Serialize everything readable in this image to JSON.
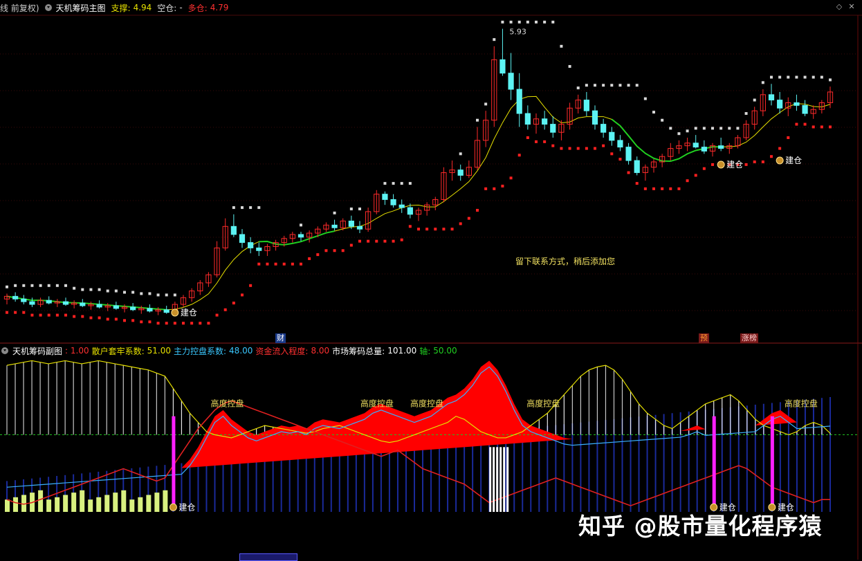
{
  "header": {
    "mode": "线 前复权)",
    "indicator": "天机筹码主图",
    "support_label": "支撑:",
    "support_value": "4.94",
    "empty_label": "空仓:",
    "empty_value": "-",
    "long_label": "多仓:",
    "long_value": "4.79"
  },
  "sub_header": {
    "indicator": "天机筹码副图",
    "param0": ": 1.00",
    "retail_label": "散户套牢系数:",
    "retail_value": "51.00",
    "main_label": "主力控盘系数:",
    "main_value": "48.00",
    "inflow_label": "资金流入程度:",
    "inflow_value": "8.00",
    "total_label": "市场筹码总量:",
    "total_value": "101.00",
    "axis_label": "轴:",
    "axis_value": "50.00"
  },
  "annotations": {
    "peak_price": "5.93",
    "note": "留下联系方式，稍后添加您",
    "build_label": "建仓",
    "high_control_label": "高度控盘",
    "marker_cai": "财",
    "marker_yu": "预",
    "marker_zhangting": "涨榜"
  },
  "watermark": "知乎 @股市量化程序猿",
  "colors": {
    "up": "#ff2a2a",
    "down": "#5cf3f3",
    "bg": "#000000",
    "support": "#d8d8d8",
    "long_line": "#ff2020",
    "yellow": "#e6e000",
    "green": "#20d020",
    "magenta": "#ff20ff",
    "navy": "#1a2a9a"
  },
  "chart_data": [
    {
      "type": "candlestick",
      "title": "天机筹码主图",
      "candles": [
        [
          3.92,
          3.96,
          3.88,
          3.94
        ],
        [
          3.94,
          3.97,
          3.9,
          3.92
        ],
        [
          3.92,
          3.95,
          3.88,
          3.9
        ],
        [
          3.9,
          3.93,
          3.86,
          3.88
        ],
        [
          3.88,
          3.93,
          3.86,
          3.91
        ],
        [
          3.91,
          3.94,
          3.88,
          3.89
        ],
        [
          3.89,
          3.92,
          3.86,
          3.9
        ],
        [
          3.9,
          3.93,
          3.87,
          3.88
        ],
        [
          3.88,
          3.91,
          3.85,
          3.89
        ],
        [
          3.89,
          3.92,
          3.86,
          3.87
        ],
        [
          3.87,
          3.9,
          3.84,
          3.88
        ],
        [
          3.88,
          3.91,
          3.85,
          3.86
        ],
        [
          3.86,
          3.89,
          3.83,
          3.87
        ],
        [
          3.87,
          3.9,
          3.84,
          3.85
        ],
        [
          3.85,
          3.88,
          3.82,
          3.86
        ],
        [
          3.86,
          3.89,
          3.83,
          3.84
        ],
        [
          3.84,
          3.87,
          3.81,
          3.85
        ],
        [
          3.85,
          3.88,
          3.82,
          3.83
        ],
        [
          3.83,
          3.86,
          3.8,
          3.84
        ],
        [
          3.84,
          3.87,
          3.81,
          3.82
        ],
        [
          3.82,
          3.9,
          3.8,
          3.88
        ],
        [
          3.88,
          3.95,
          3.86,
          3.93
        ],
        [
          3.93,
          4.0,
          3.9,
          3.98
        ],
        [
          3.98,
          4.06,
          3.95,
          4.04
        ],
        [
          4.04,
          4.12,
          4.01,
          4.1
        ],
        [
          4.1,
          4.35,
          4.08,
          4.3
        ],
        [
          4.3,
          4.52,
          4.28,
          4.46
        ],
        [
          4.46,
          4.55,
          4.38,
          4.4
        ],
        [
          4.4,
          4.44,
          4.3,
          4.34
        ],
        [
          4.34,
          4.38,
          4.26,
          4.3
        ],
        [
          4.3,
          4.34,
          4.24,
          4.28
        ],
        [
          4.28,
          4.33,
          4.24,
          4.31
        ],
        [
          4.31,
          4.36,
          4.28,
          4.34
        ],
        [
          4.34,
          4.39,
          4.31,
          4.37
        ],
        [
          4.37,
          4.42,
          4.34,
          4.4
        ],
        [
          4.4,
          4.42,
          4.35,
          4.38
        ],
        [
          4.38,
          4.43,
          4.34,
          4.41
        ],
        [
          4.41,
          4.46,
          4.38,
          4.44
        ],
        [
          4.44,
          4.49,
          4.42,
          4.47
        ],
        [
          4.47,
          4.51,
          4.43,
          4.45
        ],
        [
          4.45,
          4.52,
          4.43,
          4.5
        ],
        [
          4.5,
          4.54,
          4.44,
          4.46
        ],
        [
          4.46,
          4.5,
          4.41,
          4.44
        ],
        [
          4.44,
          4.6,
          4.42,
          4.57
        ],
        [
          4.57,
          4.73,
          4.55,
          4.7
        ],
        [
          4.7,
          4.72,
          4.62,
          4.66
        ],
        [
          4.66,
          4.7,
          4.6,
          4.62
        ],
        [
          4.62,
          4.66,
          4.56,
          4.6
        ],
        [
          4.6,
          4.63,
          4.52,
          4.55
        ],
        [
          4.55,
          4.6,
          4.5,
          4.58
        ],
        [
          4.58,
          4.64,
          4.54,
          4.62
        ],
        [
          4.62,
          4.68,
          4.58,
          4.66
        ],
        [
          4.66,
          4.9,
          4.64,
          4.86
        ],
        [
          4.86,
          4.95,
          4.8,
          4.88
        ],
        [
          4.88,
          4.92,
          4.8,
          4.84
        ],
        [
          4.84,
          4.95,
          4.82,
          4.9
        ],
        [
          4.9,
          5.2,
          4.88,
          5.1
        ],
        [
          5.1,
          5.32,
          5.05,
          5.25
        ],
        [
          5.25,
          5.8,
          5.2,
          5.7
        ],
        [
          5.7,
          5.93,
          5.58,
          5.6
        ],
        [
          5.6,
          5.75,
          5.4,
          5.48
        ],
        [
          5.48,
          5.6,
          5.2,
          5.3
        ],
        [
          5.3,
          5.36,
          5.18,
          5.22
        ],
        [
          5.22,
          5.3,
          5.15,
          5.26
        ],
        [
          5.26,
          5.32,
          5.18,
          5.22
        ],
        [
          5.22,
          5.28,
          5.12,
          5.16
        ],
        [
          5.16,
          5.25,
          5.1,
          5.22
        ],
        [
          5.22,
          5.38,
          5.18,
          5.34
        ],
        [
          5.34,
          5.44,
          5.3,
          5.4
        ],
        [
          5.4,
          5.46,
          5.28,
          5.32
        ],
        [
          5.32,
          5.36,
          5.18,
          5.22
        ],
        [
          5.22,
          5.26,
          5.12,
          5.16
        ],
        [
          5.16,
          5.2,
          5.06,
          5.1
        ],
        [
          5.1,
          5.14,
          5.02,
          5.05
        ],
        [
          5.05,
          5.08,
          4.92,
          4.95
        ],
        [
          4.95,
          4.98,
          4.84,
          4.86
        ],
        [
          4.86,
          4.92,
          4.8,
          4.9
        ],
        [
          4.9,
          4.96,
          4.86,
          4.94
        ],
        [
          4.94,
          5.0,
          4.9,
          4.98
        ],
        [
          4.98,
          5.08,
          4.95,
          5.04
        ],
        [
          5.04,
          5.1,
          5.0,
          5.06
        ],
        [
          5.06,
          5.12,
          5.02,
          5.08
        ],
        [
          5.08,
          5.14,
          5.04,
          5.05
        ],
        [
          5.05,
          5.1,
          5.0,
          5.02
        ],
        [
          5.02,
          5.08,
          4.98,
          5.06
        ],
        [
          5.06,
          5.12,
          5.02,
          5.04
        ],
        [
          5.04,
          5.08,
          5.0,
          5.06
        ],
        [
          5.06,
          5.14,
          5.04,
          5.12
        ],
        [
          5.12,
          5.25,
          5.1,
          5.22
        ],
        [
          5.22,
          5.35,
          5.18,
          5.32
        ],
        [
          5.32,
          5.48,
          5.28,
          5.44
        ],
        [
          5.44,
          5.52,
          5.36,
          5.4
        ],
        [
          5.4,
          5.46,
          5.3,
          5.34
        ],
        [
          5.34,
          5.42,
          5.28,
          5.38
        ],
        [
          5.38,
          5.44,
          5.32,
          5.36
        ],
        [
          5.36,
          5.4,
          5.28,
          5.3
        ],
        [
          5.3,
          5.36,
          5.26,
          5.33
        ],
        [
          5.33,
          5.4,
          5.3,
          5.38
        ],
        [
          5.38,
          5.5,
          5.34,
          5.46
        ]
      ],
      "labels": [
        "5.93",
        "建仓",
        "留下联系方式，稍后添加您"
      ]
    },
    {
      "type": "area",
      "title": "天机筹码副图",
      "series": [
        {
          "name": "散户套牢系数",
          "last": 51.0
        },
        {
          "name": "主力控盘系数",
          "last": 48.0
        },
        {
          "name": "资金流入程度",
          "last": 8.0
        },
        {
          "name": "市场筹码总量",
          "last": 101.0
        },
        {
          "name": "轴",
          "last": 50.0
        }
      ],
      "control": [
        0,
        0,
        0,
        0,
        0,
        0,
        0,
        0,
        0,
        0,
        0,
        0,
        0,
        0,
        0,
        0,
        0,
        0,
        0,
        0,
        22,
        28,
        34,
        42,
        52,
        62,
        66,
        60,
        56,
        52,
        50,
        52,
        54,
        56,
        55,
        56,
        54,
        58,
        60,
        59,
        58,
        60,
        62,
        64,
        68,
        70,
        68,
        66,
        64,
        62,
        64,
        66,
        70,
        74,
        76,
        80,
        86,
        94,
        98,
        92,
        82,
        70,
        60,
        56,
        54,
        52,
        50,
        48,
        46,
        44,
        42,
        40,
        38,
        36,
        34,
        36,
        40,
        44,
        46,
        48,
        50,
        52,
        54,
        56,
        52,
        50,
        48,
        50,
        52,
        54,
        56,
        60,
        64,
        66,
        62,
        58,
        56,
        52,
        50,
        48
      ],
      "retail": [
        95,
        96,
        97,
        98,
        97,
        96,
        97,
        98,
        97,
        96,
        97,
        98,
        97,
        96,
        95,
        94,
        93,
        92,
        90,
        88,
        80,
        72,
        64,
        58,
        52,
        50,
        49,
        48,
        50,
        52,
        54,
        56,
        55,
        54,
        53,
        52,
        51,
        52,
        54,
        55,
        56,
        54,
        52,
        50,
        48,
        46,
        45,
        46,
        48,
        50,
        52,
        54,
        56,
        58,
        62,
        60,
        56,
        52,
        50,
        48,
        48,
        50,
        52,
        56,
        60,
        64,
        70,
        76,
        82,
        88,
        92,
        94,
        95,
        92,
        86,
        78,
        70,
        64,
        60,
        56,
        54,
        58,
        62,
        66,
        70,
        72,
        74,
        76,
        72,
        66,
        60,
        56,
        54,
        52,
        50,
        52,
        56,
        58,
        56,
        51
      ],
      "inflow": [
        8,
        6,
        5,
        6,
        8,
        10,
        12,
        14,
        16,
        18,
        20,
        22,
        24,
        26,
        28,
        26,
        24,
        22,
        20,
        22,
        30,
        38,
        46,
        54,
        60,
        66,
        70,
        72,
        70,
        68,
        66,
        64,
        62,
        60,
        58,
        56,
        54,
        52,
        50,
        48,
        46,
        44,
        42,
        40,
        38,
        36,
        38,
        40,
        36,
        32,
        28,
        26,
        24,
        22,
        20,
        18,
        14,
        10,
        6,
        8,
        10,
        12,
        14,
        16,
        18,
        20,
        22,
        20,
        18,
        16,
        14,
        12,
        10,
        8,
        6,
        4,
        6,
        8,
        10,
        12,
        14,
        16,
        18,
        20,
        22,
        24,
        26,
        28,
        30,
        28,
        24,
        20,
        16,
        14,
        12,
        10,
        8,
        6,
        8,
        8
      ]
    }
  ]
}
